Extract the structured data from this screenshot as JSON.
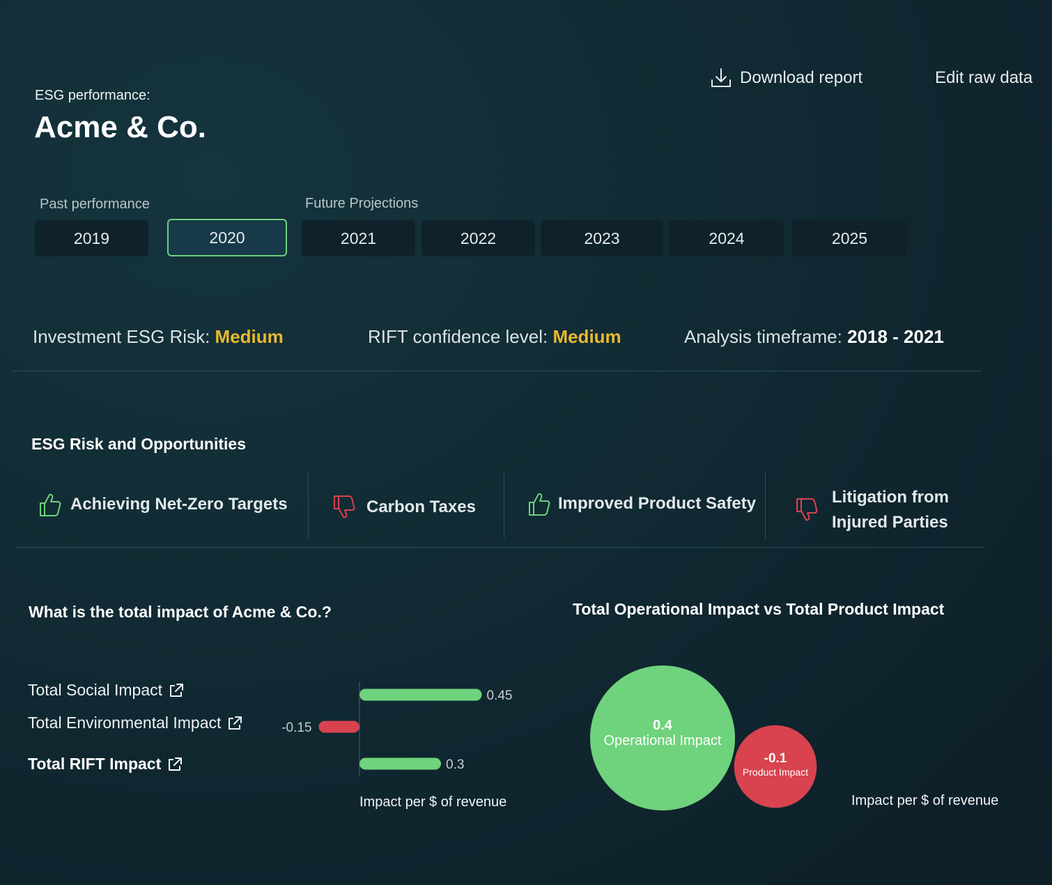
{
  "header": {
    "subtitle": "ESG performance:",
    "company": "Acme & Co.",
    "actions": {
      "download": "Download report",
      "edit": "Edit raw data"
    }
  },
  "timeline": {
    "past_label": "Past performance",
    "future_label": "Future Projections",
    "years": [
      "2019",
      "2020",
      "2021",
      "2022",
      "2023",
      "2024",
      "2025"
    ],
    "selected": "2020"
  },
  "metrics": {
    "risk_label": "Investment ESG Risk:",
    "risk_value": "Medium",
    "confidence_label": "RIFT confidence level:",
    "confidence_value": "Medium",
    "timeframe_label": "Analysis timeframe:",
    "timeframe_value": "2018 - 2021"
  },
  "risks": {
    "title": "ESG Risk and Opportunities",
    "items": [
      {
        "label": "Achieving Net-Zero Targets",
        "sentiment": "positive",
        "icon": "thumbs-up-icon"
      },
      {
        "label": "Carbon Taxes",
        "sentiment": "negative",
        "icon": "thumbs-down-icon"
      },
      {
        "label": "Improved Product Safety",
        "sentiment": "positive",
        "icon": "thumbs-up-icon"
      },
      {
        "label": "Litigation from Injured Parties",
        "label_line1": "Litigation from",
        "label_line2": "Injured Parties",
        "sentiment": "negative",
        "icon": "thumbs-down-icon"
      }
    ]
  },
  "impact": {
    "title": "What is the total impact of Acme & Co.?",
    "rows": [
      {
        "label": "Total Social Impact"
      },
      {
        "label": "Total Environmental Impact"
      },
      {
        "label": "Total RIFT Impact"
      }
    ],
    "axis_label": "Impact per $ of revenue"
  },
  "bubbles": {
    "title": "Total Operational Impact vs Total Product Impact",
    "axis_label": "Impact per $ of revenue"
  },
  "colors": {
    "positive": "#6fd27c",
    "negative": "#d8434f",
    "highlight": "#e9b92e"
  },
  "chart_data": [
    {
      "type": "bar",
      "orientation": "horizontal",
      "categories": [
        "Total Social Impact",
        "Total Environmental Impact",
        "Total RIFT Impact"
      ],
      "values": [
        0.45,
        -0.15,
        0.3
      ],
      "value_labels": [
        "0.45",
        "-0.15",
        "0.3"
      ],
      "xlabel": "Impact per $ of revenue",
      "xlim": [
        -0.15,
        0.45
      ]
    },
    {
      "type": "scatter",
      "subtype": "bubble",
      "title": "Total Operational Impact vs Total Product Impact",
      "points": [
        {
          "name": "Operational Impact",
          "value": 0.4,
          "value_label": "0.4",
          "color": "#6fd27c"
        },
        {
          "name": "Product Impact",
          "value": -0.1,
          "value_label": "-0.1",
          "color": "#d8434f"
        }
      ],
      "xlabel": "Impact per $ of revenue"
    }
  ]
}
